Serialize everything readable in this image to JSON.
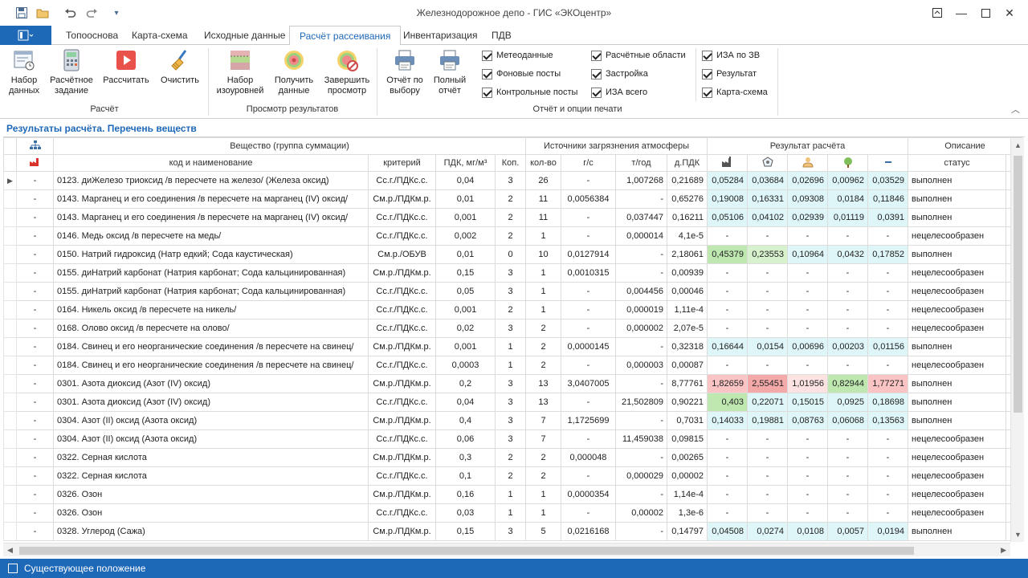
{
  "window": {
    "title": "Железнодорожное депо - ГИС «ЭКОцентр»"
  },
  "quick_access": [
    "save-icon",
    "open-folder-icon",
    "undo-icon",
    "redo-icon",
    "customize-icon"
  ],
  "tabs": [
    "Топооснова",
    "Карта-схема",
    "Исходные данные",
    "Расчёт рассеивания",
    "Инвентаризация",
    "ПДВ"
  ],
  "active_tab": "Расчёт рассеивания",
  "ribbon": {
    "groups": {
      "calc": "Расчёт",
      "results": "Просмотр результатов",
      "report": "Отчёт и опции печати"
    },
    "buttons": {
      "dataset": "Набор данных",
      "task": "Расчётное задание",
      "calculate": "Рассчитать",
      "clear": "Очистить",
      "isolines": "Набор изоуровней",
      "get_data": "Получить данные",
      "finish_view": "Завершить просмотр",
      "report_selected": "Отчёт по выбору",
      "report_full": "Полный отчёт"
    },
    "checkboxes": [
      {
        "label": "Метеоданные",
        "checked": true
      },
      {
        "label": "Фоновые посты",
        "checked": true
      },
      {
        "label": "Контрольные посты",
        "checked": true
      },
      {
        "label": "Расчётные области",
        "checked": true
      },
      {
        "label": "Застройка",
        "checked": true
      },
      {
        "label": "ИЗА всего",
        "checked": true
      },
      {
        "label": "ИЗА по ЗВ",
        "checked": true
      },
      {
        "label": "Результат",
        "checked": true
      },
      {
        "label": "Карта-схема",
        "checked": true
      }
    ]
  },
  "panel": {
    "title": "Результаты расчёта. Перечень веществ"
  },
  "grid": {
    "group_headers": {
      "substance": "Вещество (группа суммации)",
      "sources": "Источники загрязнения атмосферы",
      "result": "Результат расчёта",
      "description": "Описание"
    },
    "headers": {
      "code_name": "код и наименование",
      "criterion": "критерий",
      "pdk": "ПДК, мг/м³",
      "kop": "Коп.",
      "count": "кол-во",
      "gs": "г/с",
      "tyear": "т/год",
      "dpdk": "д.ПДК",
      "status": "статус"
    },
    "result_icons": [
      "factory-icon",
      "zone-icon",
      "person-icon",
      "tree-icon",
      "minus-icon"
    ],
    "rows": [
      {
        "mark": "-",
        "name": "0123. диЖелезо триоксид /в пересчете на железо/ (Железа оксид)",
        "crit": "Сс.г./ПДКс.с.",
        "pdk": "0,04",
        "kop": "3",
        "count": "26",
        "gs": "-",
        "ty": "1,007268",
        "dp": "0,21689",
        "r1": "0,05284",
        "r2": "0,03684",
        "r3": "0,02696",
        "r4": "0,00962",
        "r5": "0,03529",
        "status": "выполнен"
      },
      {
        "mark": "-",
        "name": "0143. Марганец и его соединения /в пересчете на марганец (IV) оксид/",
        "crit": "См.р./ПДКм.р.",
        "pdk": "0,01",
        "kop": "2",
        "count": "11",
        "gs": "0,0056384",
        "ty": "-",
        "dp": "0,65276",
        "r1": "0,19008",
        "r2": "0,16331",
        "r3": "0,09308",
        "r4": "0,0184",
        "r5": "0,11846",
        "status": "выполнен"
      },
      {
        "mark": "-",
        "name": "0143. Марганец и его соединения /в пересчете на марганец (IV) оксид/",
        "crit": "Сс.г./ПДКс.с.",
        "pdk": "0,001",
        "kop": "2",
        "count": "11",
        "gs": "-",
        "ty": "0,037447",
        "dp": "0,16211",
        "r1": "0,05106",
        "r2": "0,04102",
        "r3": "0,02939",
        "r4": "0,01119",
        "r5": "0,0391",
        "status": "выполнен"
      },
      {
        "mark": "-",
        "name": "0146. Медь оксид /в пересчете на медь/",
        "crit": "Сс.г./ПДКс.с.",
        "pdk": "0,002",
        "kop": "2",
        "count": "1",
        "gs": "-",
        "ty": "0,000014",
        "dp": "4,1е-5",
        "r1": "-",
        "r2": "-",
        "r3": "-",
        "r4": "-",
        "r5": "-",
        "status": "нецелесообразен"
      },
      {
        "mark": "-",
        "name": "0150. Натрий гидроксид (Натр едкий; Сода каустическая)",
        "crit": "См.р./ОБУВ",
        "pdk": "0,01",
        "kop": "0",
        "count": "10",
        "gs": "0,0127914",
        "ty": "-",
        "dp": "2,18061",
        "r1": "0,45379",
        "r2": "0,23553",
        "r3": "0,10964",
        "r4": "0,0432",
        "r5": "0,17852",
        "status": "выполнен"
      },
      {
        "mark": "-",
        "name": "0155. диНатрий карбонат (Натрия карбонат; Сода кальцинированная)",
        "crit": "См.р./ПДКм.р.",
        "pdk": "0,15",
        "kop": "3",
        "count": "1",
        "gs": "0,0010315",
        "ty": "-",
        "dp": "0,00939",
        "r1": "-",
        "r2": "-",
        "r3": "-",
        "r4": "-",
        "r5": "-",
        "status": "нецелесообразен"
      },
      {
        "mark": "-",
        "name": "0155. диНатрий карбонат (Натрия карбонат; Сода кальцинированная)",
        "crit": "Сс.г./ПДКс.с.",
        "pdk": "0,05",
        "kop": "3",
        "count": "1",
        "gs": "-",
        "ty": "0,004456",
        "dp": "0,00046",
        "r1": "-",
        "r2": "-",
        "r3": "-",
        "r4": "-",
        "r5": "-",
        "status": "нецелесообразен"
      },
      {
        "mark": "-",
        "name": "0164. Никель оксид /в пересчете на никель/",
        "crit": "Сс.г./ПДКс.с.",
        "pdk": "0,001",
        "kop": "2",
        "count": "1",
        "gs": "-",
        "ty": "0,000019",
        "dp": "1,11е-4",
        "r1": "-",
        "r2": "-",
        "r3": "-",
        "r4": "-",
        "r5": "-",
        "status": "нецелесообразен"
      },
      {
        "mark": "-",
        "name": "0168. Олово оксид /в пересчете на олово/",
        "crit": "Сс.г./ПДКс.с.",
        "pdk": "0,02",
        "kop": "3",
        "count": "2",
        "gs": "-",
        "ty": "0,000002",
        "dp": "2,07е-5",
        "r1": "-",
        "r2": "-",
        "r3": "-",
        "r4": "-",
        "r5": "-",
        "status": "нецелесообразен"
      },
      {
        "mark": "-",
        "name": "0184. Свинец и его неорганические соединения /в пересчете на свинец/",
        "crit": "См.р./ПДКм.р.",
        "pdk": "0,001",
        "kop": "1",
        "count": "2",
        "gs": "0,0000145",
        "ty": "-",
        "dp": "0,32318",
        "r1": "0,16644",
        "r2": "0,0154",
        "r3": "0,00696",
        "r4": "0,00203",
        "r5": "0,01156",
        "status": "выполнен"
      },
      {
        "mark": "-",
        "name": "0184. Свинец и его неорганические соединения /в пересчете на свинец/",
        "crit": "Сс.г./ПДКс.с.",
        "pdk": "0,0003",
        "kop": "1",
        "count": "2",
        "gs": "-",
        "ty": "0,000003",
        "dp": "0,00087",
        "r1": "-",
        "r2": "-",
        "r3": "-",
        "r4": "-",
        "r5": "-",
        "status": "нецелесообразен"
      },
      {
        "mark": "-",
        "name": "0301. Азота диоксид (Азот (IV) оксид)",
        "crit": "См.р./ПДКм.р.",
        "pdk": "0,2",
        "kop": "3",
        "count": "13",
        "gs": "3,0407005",
        "ty": "-",
        "dp": "8,77761",
        "r1": "1,82659",
        "r2": "2,55451",
        "r3": "1,01956",
        "r4": "0,82944",
        "r5": "1,77271",
        "status": "выполнен"
      },
      {
        "mark": "-",
        "name": "0301. Азота диоксид (Азот (IV) оксид)",
        "crit": "Сс.г./ПДКс.с.",
        "pdk": "0,04",
        "kop": "3",
        "count": "13",
        "gs": "-",
        "ty": "21,502809",
        "dp": "0,90221",
        "r1": "0,403",
        "r2": "0,22071",
        "r3": "0,15015",
        "r4": "0,0925",
        "r5": "0,18698",
        "status": "выполнен"
      },
      {
        "mark": "-",
        "name": "0304. Азот (II) оксид (Азота оксид)",
        "crit": "См.р./ПДКм.р.",
        "pdk": "0,4",
        "kop": "3",
        "count": "7",
        "gs": "1,1725699",
        "ty": "-",
        "dp": "0,7031",
        "r1": "0,14033",
        "r2": "0,19881",
        "r3": "0,08763",
        "r4": "0,06068",
        "r5": "0,13563",
        "status": "выполнен"
      },
      {
        "mark": "-",
        "name": "0304. Азот (II) оксид (Азота оксид)",
        "crit": "Сс.г./ПДКс.с.",
        "pdk": "0,06",
        "kop": "3",
        "count": "7",
        "gs": "-",
        "ty": "11,459038",
        "dp": "0,09815",
        "r1": "-",
        "r2": "-",
        "r3": "-",
        "r4": "-",
        "r5": "-",
        "status": "нецелесообразен"
      },
      {
        "mark": "-",
        "name": "0322. Серная кислота",
        "crit": "См.р./ПДКм.р.",
        "pdk": "0,3",
        "kop": "2",
        "count": "2",
        "gs": "0,000048",
        "ty": "-",
        "dp": "0,00265",
        "r1": "-",
        "r2": "-",
        "r3": "-",
        "r4": "-",
        "r5": "-",
        "status": "нецелесообразен"
      },
      {
        "mark": "-",
        "name": "0322. Серная кислота",
        "crit": "Сс.г./ПДКс.с.",
        "pdk": "0,1",
        "kop": "2",
        "count": "2",
        "gs": "-",
        "ty": "0,000029",
        "dp": "0,00002",
        "r1": "-",
        "r2": "-",
        "r3": "-",
        "r4": "-",
        "r5": "-",
        "status": "нецелесообразен"
      },
      {
        "mark": "-",
        "name": "0326. Озон",
        "crit": "См.р./ПДКм.р.",
        "pdk": "0,16",
        "kop": "1",
        "count": "1",
        "gs": "0,0000354",
        "ty": "-",
        "dp": "1,14е-4",
        "r1": "-",
        "r2": "-",
        "r3": "-",
        "r4": "-",
        "r5": "-",
        "status": "нецелесообразен"
      },
      {
        "mark": "-",
        "name": "0326. Озон",
        "crit": "Сс.г./ПДКс.с.",
        "pdk": "0,03",
        "kop": "1",
        "count": "1",
        "gs": "-",
        "ty": "0,00002",
        "dp": "1,3е-6",
        "r1": "-",
        "r2": "-",
        "r3": "-",
        "r4": "-",
        "r5": "-",
        "status": "нецелесообразен"
      },
      {
        "mark": "-",
        "name": "0328. Углерод (Сажа)",
        "crit": "См.р./ПДКм.р.",
        "pdk": "0,15",
        "kop": "3",
        "count": "5",
        "gs": "0,0216168",
        "ty": "-",
        "dp": "0,14797",
        "r1": "0,04508",
        "r2": "0,0274",
        "r3": "0,0108",
        "r4": "0,0057",
        "r5": "0,0194",
        "status": "выполнен"
      }
    ]
  },
  "statusbar": {
    "text": "Существующее положение"
  },
  "colors": {
    "accent": "#1e68b8",
    "cell_cyan": "#dff6f9",
    "cell_red_strong": "#f4a9a9",
    "cell_red": "#fbc4c4",
    "cell_red_light": "#fde2e2",
    "cell_green": "#bfe8b1",
    "cell_green_light": "#d7f1cc"
  }
}
